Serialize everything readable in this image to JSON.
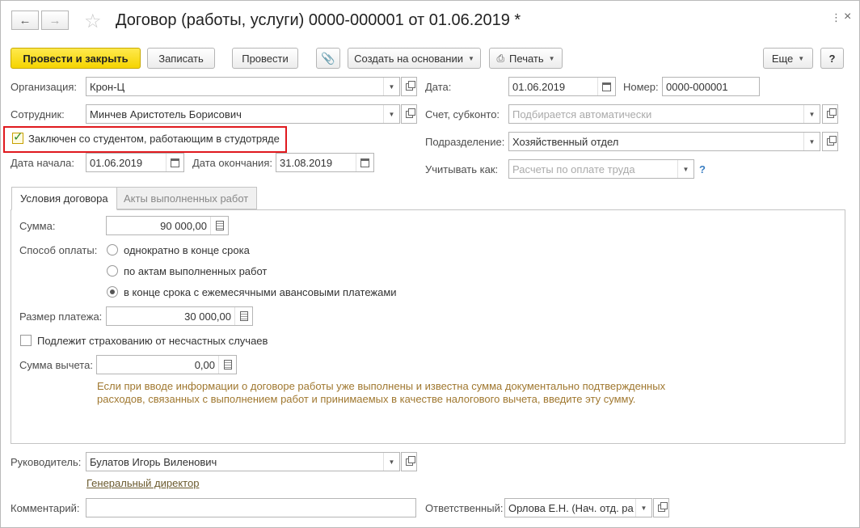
{
  "window": {
    "title": "Договор (работы, услуги) 0000-000001 от 01.06.2019 *"
  },
  "toolbar": {
    "post_close": "Провести и закрыть",
    "save": "Записать",
    "post": "Провести",
    "create_based": "Создать на основании",
    "print": "Печать",
    "more": "Еще",
    "help": "?"
  },
  "form": {
    "organization": {
      "label": "Организация:",
      "value": "Крон-Ц"
    },
    "employee": {
      "label": "Сотрудник:",
      "value": "Минчев Аристотель Борисович"
    },
    "student_check": {
      "label": "Заключен со студентом, работающим в студотряде",
      "checked": true
    },
    "start_date": {
      "label": "Дата начала:",
      "value": "01.06.2019"
    },
    "end_date": {
      "label": "Дата окончания:",
      "value": "31.08.2019"
    },
    "date": {
      "label": "Дата:",
      "value": "01.06.2019"
    },
    "number": {
      "label": "Номер:",
      "value": "0000-000001"
    },
    "account": {
      "label": "Счет, субконто:",
      "placeholder": "Подбирается автоматически"
    },
    "department": {
      "label": "Подразделение:",
      "value": "Хозяйственный отдел"
    },
    "account_as": {
      "label": "Учитывать как:",
      "placeholder": "Расчеты по оплате труда",
      "help": "?"
    }
  },
  "tabs": [
    {
      "label": "Условия договора",
      "active": true
    },
    {
      "label": "Акты выполненных работ",
      "active": false
    }
  ],
  "terms": {
    "amount": {
      "label": "Сумма:",
      "value": "90 000,00"
    },
    "payment_method_label": "Способ оплаты:",
    "payment_options": [
      {
        "label": "однократно в конце срока",
        "selected": false
      },
      {
        "label": "по актам выполненных работ",
        "selected": false
      },
      {
        "label": "в конце срока с ежемесячными авансовыми платежами",
        "selected": true
      }
    ],
    "payment_size": {
      "label": "Размер платежа:",
      "value": "30 000,00"
    },
    "insurance": {
      "label": "Подлежит страхованию от несчастных случаев",
      "checked": false
    },
    "deduction": {
      "label": "Сумма вычета:",
      "value": "0,00"
    },
    "hint_line1": "Если при вводе информации о договоре работы уже выполнены и известна сумма документально подтвержденных",
    "hint_line2": "расходов, связанных с выполнением работ и принимаемых в качестве налогового вычета, введите эту сумму."
  },
  "footer": {
    "manager": {
      "label": "Руководитель:",
      "value": "Булатов Игорь Виленович",
      "position": "Генеральный директор"
    },
    "comment": {
      "label": "Комментарий:",
      "value": ""
    },
    "responsible": {
      "label": "Ответственный:",
      "value": "Орлова Е.Н. (Нач. отд. ра"
    }
  },
  "colors": {
    "accent_yellow": "#f5d400",
    "highlight_red": "#e0191e",
    "hint_text": "#a07830",
    "check_green": "#2e8b2e"
  }
}
